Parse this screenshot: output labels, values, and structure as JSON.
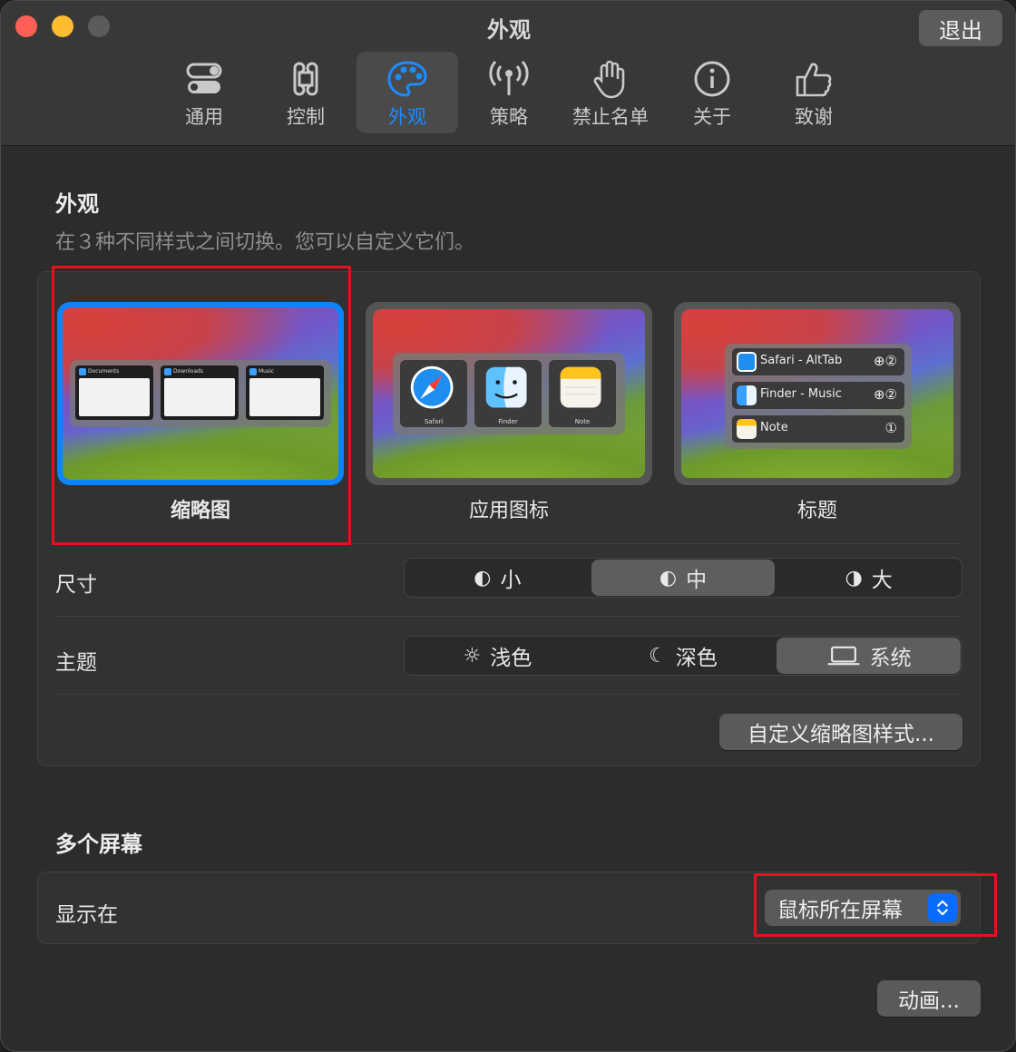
{
  "window": {
    "title": "外观",
    "quit_label": "退出"
  },
  "tabs": [
    {
      "label": "通用",
      "icon": "toggles-icon",
      "active": false
    },
    {
      "label": "控制",
      "icon": "command-icon",
      "active": false
    },
    {
      "label": "外观",
      "icon": "palette-icon",
      "active": true
    },
    {
      "label": "策略",
      "icon": "antenna-icon",
      "active": false
    },
    {
      "label": "禁止名单",
      "icon": "hand-icon",
      "active": false
    },
    {
      "label": "关于",
      "icon": "info-icon",
      "active": false
    },
    {
      "label": "致谢",
      "icon": "thumbs-up-icon",
      "active": false
    }
  ],
  "appearance": {
    "title": "外观",
    "subtitle": "在３种不同样式之间切换。您可以自定义它们。",
    "styles": [
      {
        "label": "缩略图",
        "selected": true,
        "windows": [
          "Documents",
          "Downloads",
          "Music"
        ]
      },
      {
        "label": "应用图标",
        "selected": false,
        "apps": [
          "Safari",
          "Finder",
          "Note"
        ]
      },
      {
        "label": "标题",
        "selected": false,
        "rows": [
          {
            "text": "Safari - AltTab",
            "badges": "⊕②"
          },
          {
            "text": "Finder - Music",
            "badges": "⊕②"
          },
          {
            "text": "Note",
            "badges": "①"
          }
        ]
      }
    ],
    "size": {
      "label": "尺寸",
      "options": [
        "小",
        "中",
        "大"
      ],
      "selected": "中"
    },
    "theme": {
      "label": "主题",
      "options": [
        "浅色",
        "深色",
        "系统"
      ],
      "selected": "系统"
    },
    "customize_label": "自定义缩略图样式..."
  },
  "screens": {
    "title": "多个屏幕",
    "show_on_label": "显示在",
    "show_on_value": "鼠标所在屏幕"
  },
  "animation_label": "动画...",
  "colors": {
    "accent": "#0a84ff",
    "highlight": "#e8101c"
  }
}
